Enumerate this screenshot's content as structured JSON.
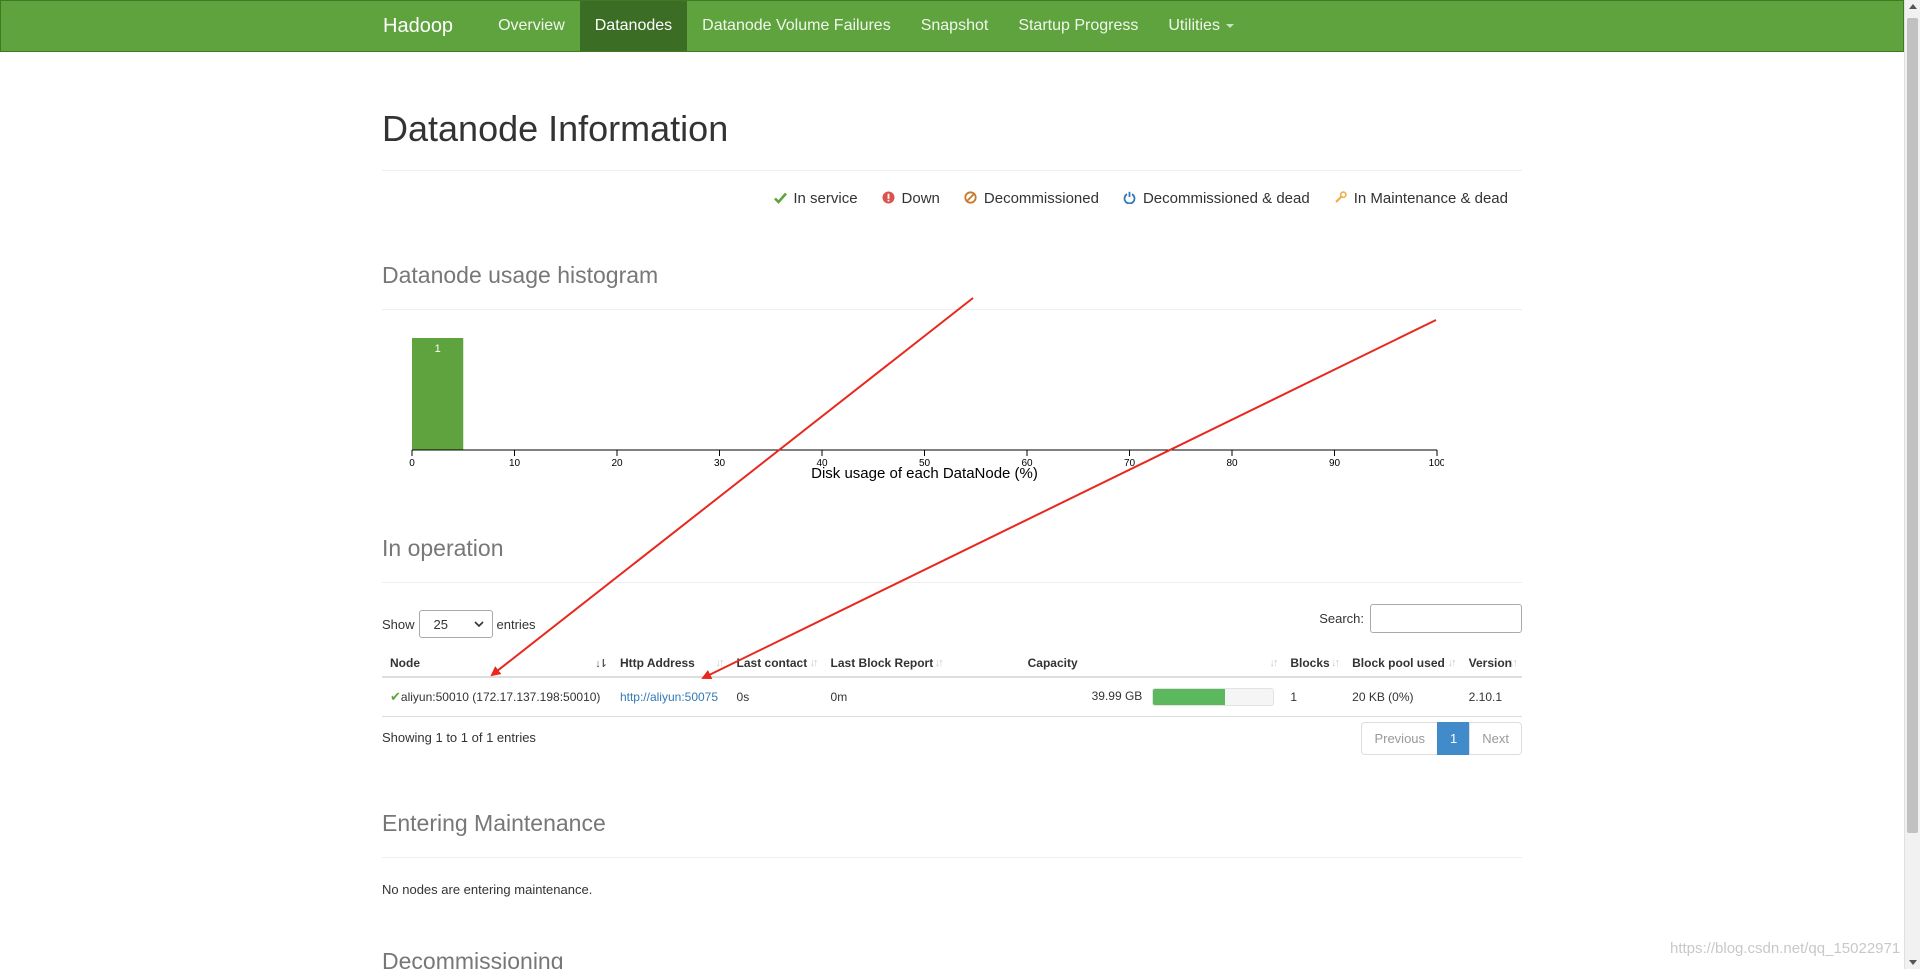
{
  "navbar": {
    "brand": "Hadoop",
    "items": [
      {
        "label": "Overview"
      },
      {
        "label": "Datanodes",
        "active": true
      },
      {
        "label": "Datanode Volume Failures"
      },
      {
        "label": "Snapshot"
      },
      {
        "label": "Startup Progress"
      },
      {
        "label": "Utilities"
      }
    ],
    "color": "#5fa33e"
  },
  "page": {
    "title": "Datanode Information"
  },
  "legend": [
    {
      "icon": "check-icon",
      "label": "In service",
      "color": "#5fa33e"
    },
    {
      "icon": "exclamation-circle-icon",
      "label": "Down",
      "color": "#d9534f"
    },
    {
      "icon": "ban-icon",
      "label": "Decommissioned",
      "color": "#c9792c"
    },
    {
      "icon": "power-icon",
      "label": "Decommissioned & dead",
      "color": "#337ab7"
    },
    {
      "icon": "wrench-icon",
      "label": "In Maintenance & dead",
      "color": "#f0ad4e"
    }
  ],
  "histogram_section": {
    "title": "Datanode usage histogram"
  },
  "chart_data": {
    "type": "bar",
    "bins": [
      [
        0,
        5
      ]
    ],
    "values": [
      1
    ],
    "xlabel": "Disk usage of each DataNode (%)",
    "xlim": [
      0,
      100
    ],
    "xticks": [
      "0",
      "10",
      "20",
      "30",
      "40",
      "50",
      "60",
      "70",
      "80",
      "90",
      "100"
    ],
    "bar_color": "#5fa33e"
  },
  "operation_section": {
    "title": "In operation",
    "show_prefix": "Show",
    "show_value": "25",
    "show_suffix": "entries",
    "search_label": "Search:",
    "search_value": "",
    "columns": [
      "Node",
      "Http Address",
      "Last contact",
      "Last Block Report",
      "Capacity",
      "Blocks",
      "Block pool used",
      "Version"
    ],
    "rows": [
      {
        "node": "aliyun:50010 (172.17.137.198:50010)",
        "http": "http://aliyun:50075",
        "last_contact": "0s",
        "last_block_report": "0m",
        "capacity": "39.99 GB",
        "capacity_used_fraction": 0.6,
        "blocks": "1",
        "block_pool_used": "20 KB (0%)",
        "version": "2.10.1"
      }
    ],
    "info": "Showing 1 to 1 of 1 entries",
    "pager": {
      "previous": "Previous",
      "current": "1",
      "next": "Next"
    }
  },
  "maintenance_section": {
    "title": "Entering Maintenance",
    "note": "No nodes are entering maintenance."
  },
  "decommissioning_section": {
    "title": "Decommissioning"
  },
  "watermark": "https://blog.csdn.net/qq_15022971"
}
